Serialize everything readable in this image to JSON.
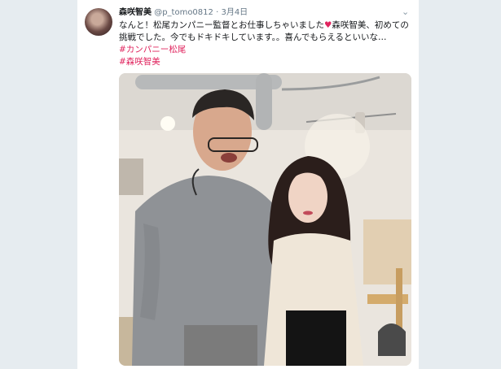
{
  "tweet": {
    "display_name": "森咲智美",
    "handle": "@p_tomo0812",
    "separator": "·",
    "date": "3月4日",
    "text_part1": "なんと！松尾カンパニー監督とお仕事しちゃいました",
    "heart": "♥",
    "text_part2": "森咲智美、初めての挑戦でした。今でもドキドキしています。。喜んでもらえるといいな…",
    "hashtags": [
      "#カンパニー松尾",
      "#森咲智美"
    ],
    "menu_icon": "chevron-down-icon"
  },
  "colors": {
    "background": "#e6ecf0",
    "card": "#ffffff",
    "hashtag": "#e0245e",
    "muted": "#657786"
  }
}
